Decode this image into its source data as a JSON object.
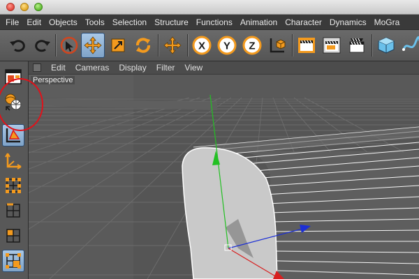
{
  "window": {
    "buttons": [
      "close",
      "minimize",
      "zoom"
    ]
  },
  "menubar": {
    "items": [
      "File",
      "Edit",
      "Objects",
      "Tools",
      "Selection",
      "Structure",
      "Functions",
      "Animation",
      "Character",
      "Dynamics",
      "MoGra"
    ]
  },
  "toolbar": {
    "buttons": [
      {
        "icon": "undo-icon"
      },
      {
        "icon": "redo-icon"
      },
      {
        "icon": "live-select-icon"
      },
      {
        "icon": "move-icon",
        "active": true
      },
      {
        "icon": "scale-icon"
      },
      {
        "icon": "rotate-icon"
      },
      {
        "icon": "move-icon"
      },
      {
        "icon": "x-axis-lock-icon",
        "label": "X"
      },
      {
        "icon": "y-axis-lock-icon",
        "label": "Y"
      },
      {
        "icon": "z-axis-lock-icon",
        "label": "Z"
      },
      {
        "icon": "world-coordinates-icon"
      },
      {
        "icon": "render-view-icon"
      },
      {
        "icon": "render-picture-viewer-icon"
      },
      {
        "icon": "render-settings-icon"
      },
      {
        "icon": "cube-icon"
      },
      {
        "icon": "spline-icon"
      }
    ]
  },
  "leftbar": {
    "buttons": [
      {
        "icon": "layout-icon"
      },
      {
        "icon": "make-editable-icon"
      },
      {
        "icon": "model-mode-icon",
        "active": true
      },
      {
        "icon": "object-axis-icon"
      },
      {
        "icon": "points-mode-icon"
      },
      {
        "icon": "edges-mode-icon"
      },
      {
        "icon": "polygons-mode-icon"
      },
      {
        "icon": "uvw-mode-icon",
        "active": true
      }
    ]
  },
  "viewport": {
    "menu": [
      "Edit",
      "Cameras",
      "Display",
      "Filter",
      "View"
    ],
    "camera_label": "Perspective"
  },
  "colors": {
    "accent_orange": "#f39a1e",
    "axis_y": "#22c022",
    "axis_x": "#d81f1f",
    "axis_z": "#1c2fd6",
    "annotation": "#e0121a",
    "active_blue": "#8fb2d6"
  }
}
